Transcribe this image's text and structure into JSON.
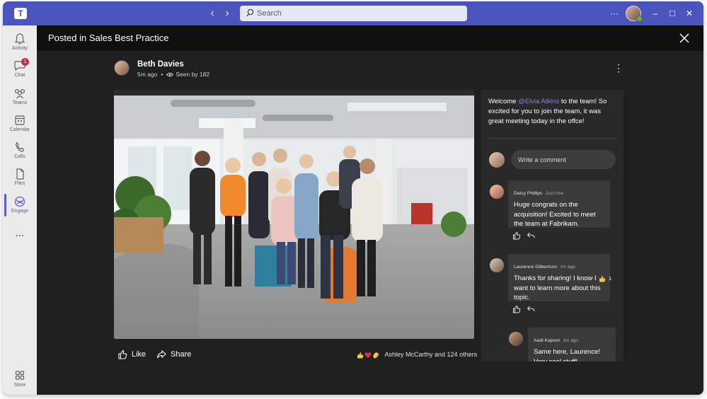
{
  "app": {
    "title_bar": {
      "search_placeholder": "Search",
      "more_label": "···",
      "minimize": "–",
      "maximize": "□",
      "close": "✕"
    }
  },
  "rail": {
    "items": [
      {
        "label": "Activity",
        "icon": "bell-icon"
      },
      {
        "label": "Chat",
        "icon": "chat-icon",
        "badge": "1"
      },
      {
        "label": "Teams",
        "icon": "teams-icon"
      },
      {
        "label": "Calendar",
        "icon": "calendar-icon"
      },
      {
        "label": "Calls",
        "icon": "phone-icon"
      },
      {
        "label": "Files",
        "icon": "file-icon"
      },
      {
        "label": "Engage",
        "icon": "engage-icon",
        "active": true
      },
      {
        "label": "Store",
        "icon": "store-icon"
      }
    ],
    "more_label": "···"
  },
  "header": {
    "title": "Posted in Sales Best Practice"
  },
  "post": {
    "author": "Beth Davies",
    "time": "5m ago",
    "seen": "Seen by 182",
    "more": "⋮",
    "like_label": "Like",
    "share_label": "Share",
    "reactions_text": "Ashley McCarthy and 124 others",
    "reaction_icons": [
      "thumbs-up-icon",
      "heart-icon",
      "clap-icon"
    ]
  },
  "panel": {
    "post_text_before": "Welcome ",
    "mention": "@Elvia Atkins",
    "post_text_after": " to the team! So excited for you to join the team, it was great meeting today in the offce!",
    "comment_placeholder": "Write a comment",
    "comments": [
      {
        "name": "Daisy Phillips",
        "time": "Just now",
        "text": "Huge congrats on the acquisition! Excited to meet the team at Fabrikam."
      },
      {
        "name": "Laurence Gilbertson",
        "time": "1m ago",
        "text": "Thanks for sharing! I know I want to learn more about this topic.",
        "reaction_count": "1"
      },
      {
        "name": "Aadi Kapoor",
        "time": "1m ago",
        "text": "Same here, Laurence! Very cool stuff!"
      }
    ]
  },
  "colors": {
    "brand": "#4b53bc",
    "accent": "#5b5fc7",
    "mention": "#7f85f5",
    "badge": "#c4314b"
  }
}
